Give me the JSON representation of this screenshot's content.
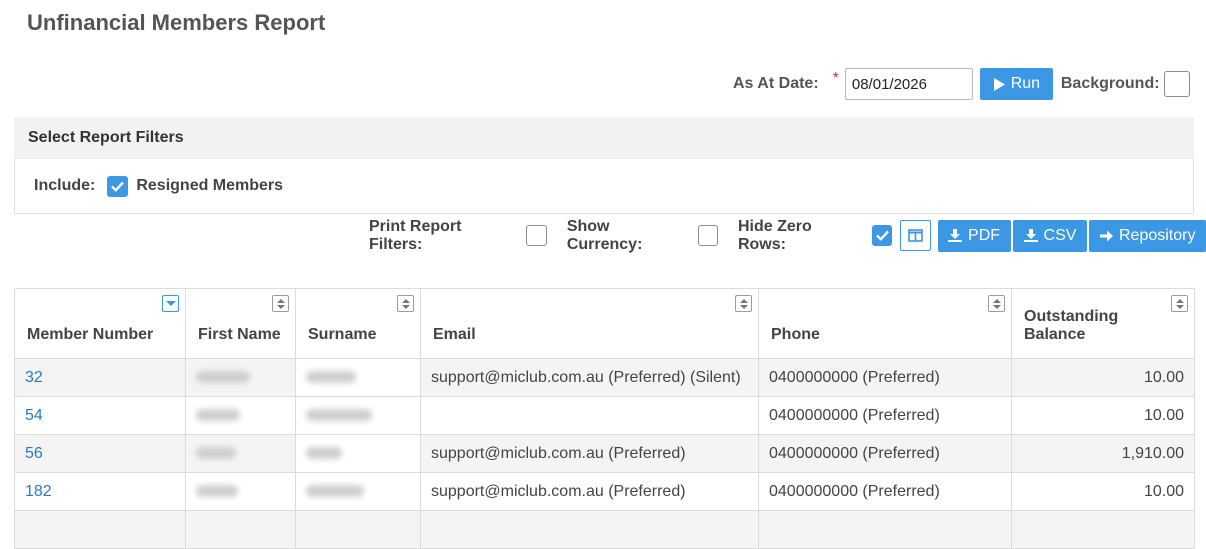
{
  "page": {
    "title": "Unfinancial Members Report"
  },
  "run_bar": {
    "as_at_label": "As At Date:",
    "required_mark": "*",
    "date_value": "08/01/2026",
    "run_label": "Run",
    "background_label": "Background:"
  },
  "filters": {
    "heading": "Select Report Filters",
    "include_label": "Include:",
    "resigned_label": "Resigned Members",
    "resigned_checked": true
  },
  "toolbar": {
    "print_filters_label": "Print Report Filters:",
    "show_currency_label": "Show Currency:",
    "hide_zero_label": "Hide Zero Rows:",
    "hide_zero_checked": true,
    "pdf_label": "PDF",
    "csv_label": "CSV",
    "repository_label": "Repository"
  },
  "table": {
    "columns": [
      "Member Number",
      "First Name",
      "Surname",
      "Email",
      "Phone",
      "Outstanding Balance"
    ],
    "rows": [
      {
        "member": "32",
        "email": "support@miclub.com.au (Preferred) (Silent)",
        "phone": "0400000000 (Preferred)",
        "balance": "10.00"
      },
      {
        "member": "54",
        "email": "",
        "phone": "0400000000 (Preferred)",
        "balance": "10.00"
      },
      {
        "member": "56",
        "email": "support@miclub.com.au (Preferred)",
        "phone": "0400000000 (Preferred)",
        "balance": "1,910.00"
      },
      {
        "member": "182",
        "email": "support@miclub.com.au (Preferred)",
        "phone": "0400000000 (Preferred)",
        "balance": "10.00"
      }
    ]
  },
  "colors": {
    "accent": "#3c97e4",
    "link": "#2a7ac0",
    "required": "#c0392b"
  }
}
